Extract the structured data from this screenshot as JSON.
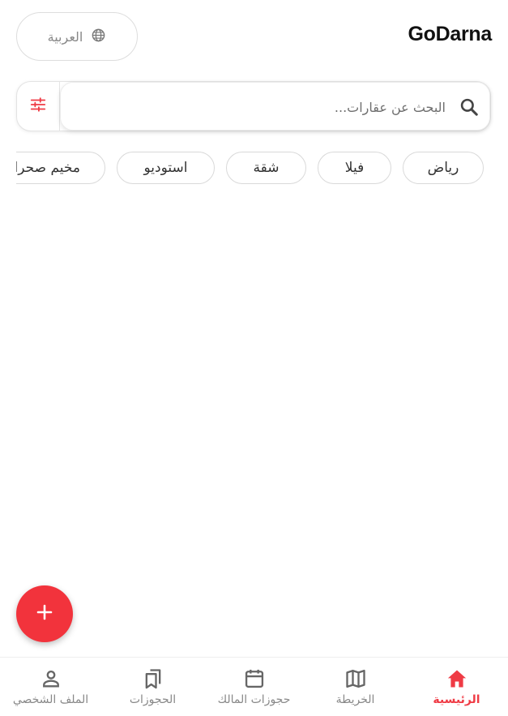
{
  "app": {
    "brand": "GoDarna"
  },
  "language_button": {
    "label": "العربية",
    "icon": "globe-icon"
  },
  "search": {
    "placeholder": "البحث عن عقارات...",
    "icon": "search-icon",
    "filter_icon": "filter-icon"
  },
  "categories": [
    {
      "label": "رياض"
    },
    {
      "label": "فيلا"
    },
    {
      "label": "شقة"
    },
    {
      "label": "استوديو"
    },
    {
      "label": "مخيم صحرا"
    }
  ],
  "fab": {
    "icon": "plus-icon"
  },
  "nav": {
    "items": [
      {
        "label": "الرئيسية",
        "icon": "home-icon",
        "active": true
      },
      {
        "label": "الخريطة",
        "icon": "map-icon",
        "active": false
      },
      {
        "label": "حجوزات المالك",
        "icon": "calendar-icon",
        "active": false
      },
      {
        "label": "الحجوزات",
        "icon": "bookmarks-icon",
        "active": false
      },
      {
        "label": "الملف الشخصي",
        "icon": "person-icon",
        "active": false
      }
    ]
  },
  "colors": {
    "accent": "#ef3b45",
    "fab": "#f2333c",
    "inactive": "#888888"
  }
}
